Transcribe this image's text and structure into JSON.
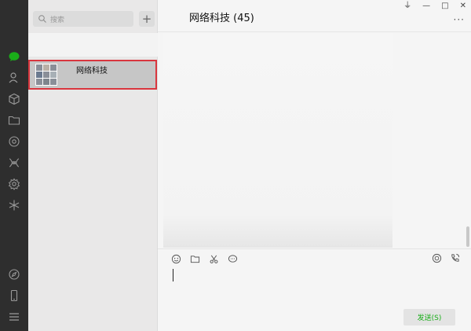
{
  "sidebar": {
    "icons": [
      "chat-icon",
      "contacts-icon",
      "box-icon",
      "folder-icon",
      "moments-icon",
      "mini-program-icon",
      "settings-gear-icon",
      "sparkle-icon",
      "compass-icon",
      "phone-icon",
      "menu-icon"
    ]
  },
  "list": {
    "search_placeholder": "搜索",
    "add_label": "+",
    "chats": [
      {
        "name": "网络科技"
      }
    ]
  },
  "chat": {
    "title": "网络科技 (45)",
    "more_label": "···",
    "send_label": "发送(S)"
  },
  "window": {
    "pin_label": "⏚",
    "minimize_label": "—",
    "maximize_label": "□",
    "close_label": "✕"
  },
  "colors": {
    "rail_bg": "#2e2e2e",
    "accent_green": "#19ad19",
    "highlight_red": "#d9363e"
  }
}
